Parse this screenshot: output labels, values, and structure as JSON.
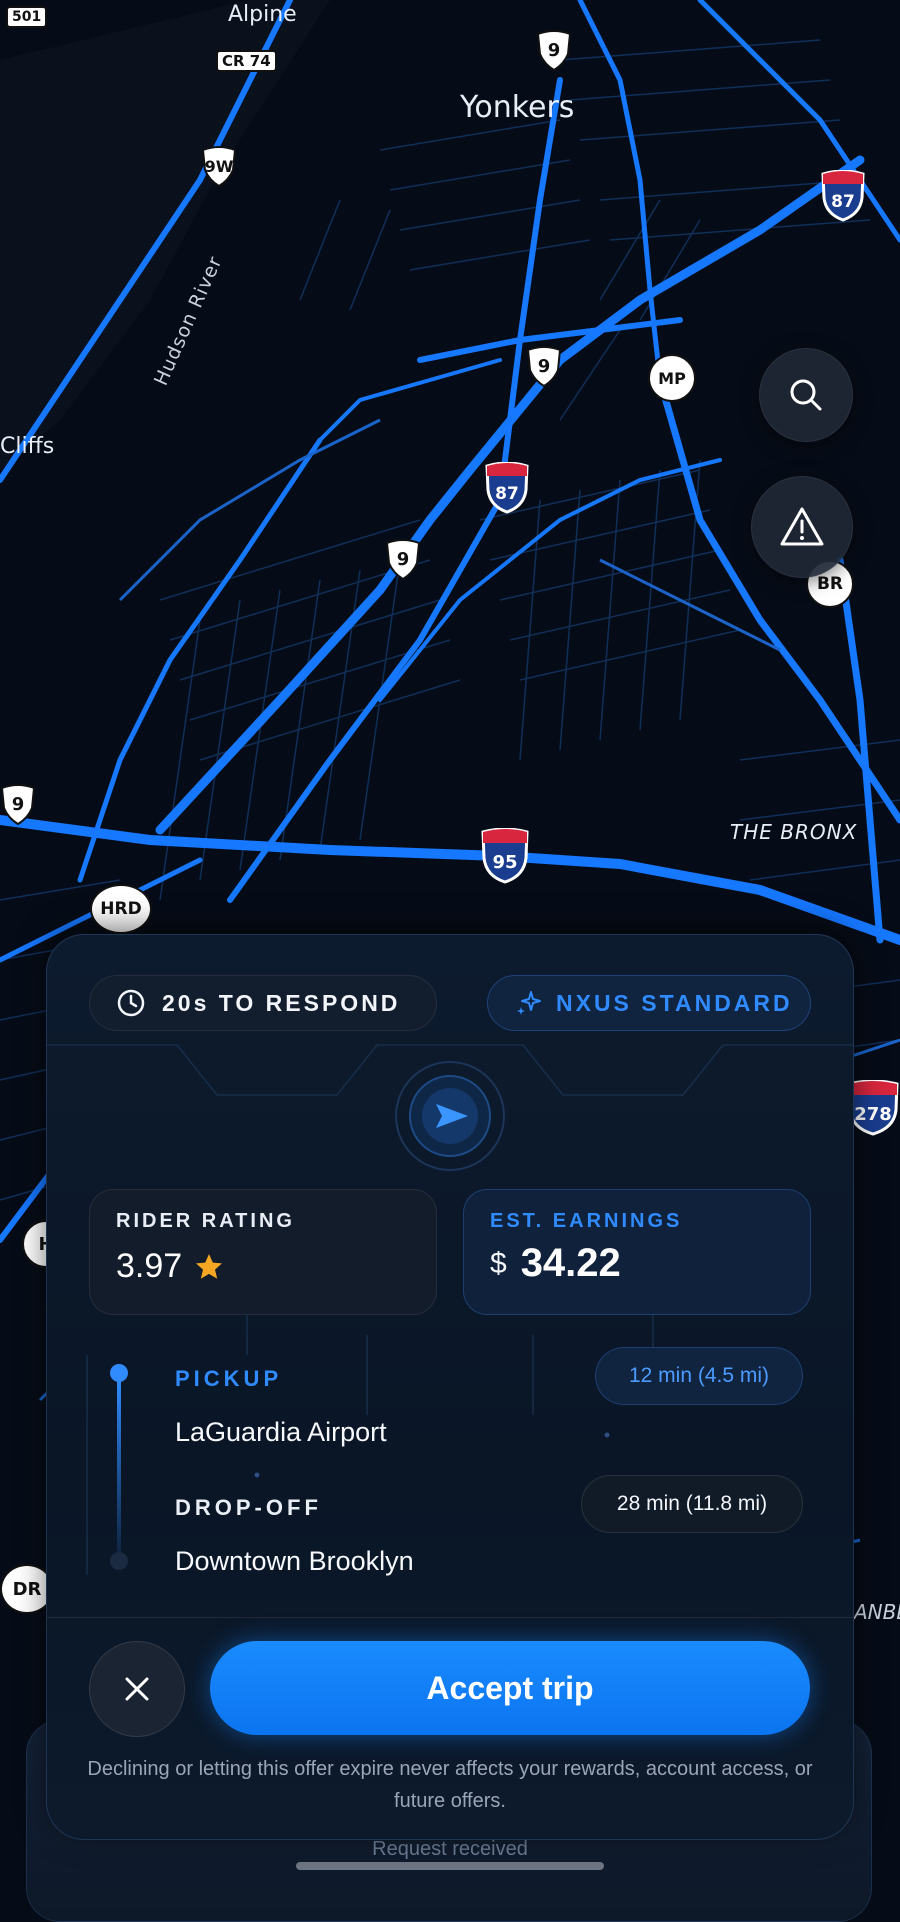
{
  "map": {
    "labels": {
      "alpine": "Alpine",
      "yonkers": "Yonkers",
      "hudson_river": "Hudson River",
      "cliffs": "Cliffs",
      "the_bronx": "THE BRONX",
      "anbe": "ANBE"
    },
    "shields": {
      "r501": "501",
      "cr74": "CR 74",
      "r9w": "9W",
      "r9_top": "9",
      "r9_mid": "9",
      "r9_low": "9",
      "r9_left": "9",
      "i87_top": "87",
      "i87_mid": "87",
      "i95": "95",
      "i278": "278",
      "mp": "MP",
      "br": "BR",
      "hrd": "HRD",
      "h": "H",
      "dr": "DR"
    },
    "road_color": "#1677ff",
    "background_color": "#060c17"
  },
  "map_controls": {
    "search_icon": "search-icon",
    "alert_icon": "alert-triangle-icon"
  },
  "offer": {
    "timer_icon": "clock-icon",
    "timer_text": "20s TO RESPOND",
    "tier_icon": "sparkle-icon",
    "tier_text": "NXUS STANDARD",
    "rating_label": "RIDER RATING",
    "rating_value": "3.97",
    "rating_icon": "star-icon",
    "earnings_label": "EST. EARNINGS",
    "earnings_currency": "$",
    "earnings_value": "34.22",
    "pickup_label": "PICKUP",
    "pickup_place": "LaGuardia Airport",
    "pickup_eta": "12 min (4.5 mi)",
    "dropoff_label": "DROP-OFF",
    "dropoff_place": "Downtown Brooklyn",
    "dropoff_eta": "28 min (11.8 mi)",
    "accept_label": "Accept trip",
    "decline_icon": "close-icon",
    "disclaimer": "Declining or letting this offer expire never affects your rewards, account access, or future offers.",
    "accent_color": "#1a8bff"
  },
  "footer": {
    "status_text": "Request received"
  }
}
